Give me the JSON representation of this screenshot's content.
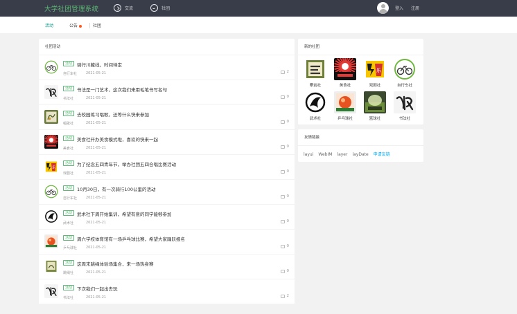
{
  "header": {
    "logo": "大学社团管理系统",
    "nav": [
      {
        "label": "交流",
        "icon": "compass-icon"
      },
      {
        "label": "社团",
        "icon": "smile-icon"
      }
    ],
    "login": "登入",
    "register": "注册"
  },
  "subnav": {
    "items": [
      {
        "label": "活动",
        "active": true
      },
      {
        "label": "公告",
        "has_dot": true
      },
      {
        "label": "社团"
      }
    ]
  },
  "feed": {
    "title": "社团活动",
    "tag_label": "活动",
    "items": [
      {
        "title": "骑行川藏线，时间待定",
        "club": "自行车社",
        "date": "2021-05-21",
        "comments": "2",
        "avatar": "bike-logo"
      },
      {
        "title": "书法是一门艺术，这次我们来用毛笔书写名句",
        "club": "书法社",
        "date": "2021-05-21",
        "comments": "0",
        "avatar": "calligraphy-logo"
      },
      {
        "title": "去校园练习唱歌，还等什么快来参加",
        "club": "唱歌社",
        "date": "2021-05-21",
        "comments": "0",
        "avatar": "singing-logo"
      },
      {
        "title": "美食社开办美食模式啦，喜欢的快来一起",
        "club": "美食社",
        "date": "2021-05-21",
        "comments": "0",
        "avatar": "food-logo"
      },
      {
        "title": "为了纪念五四青年节，举办社团五四合唱比赛活动",
        "club": "戏剧社",
        "date": "2021-05-21",
        "comments": "0",
        "avatar": "drama-logo"
      },
      {
        "title": "10月30日，有一次骑行100公里的活动",
        "club": "自行车社",
        "date": "2021-05-21",
        "comments": "0",
        "avatar": "bike-logo"
      },
      {
        "title": "武术社下周开始集训，希望有意的同学能够参加",
        "club": "武术社",
        "date": "2021-05-21",
        "comments": "0",
        "avatar": "martial-logo"
      },
      {
        "title": "周六学校体育馆有一场乒乓球比赛，希望大家踊跃报名",
        "club": "乒乓球社",
        "date": "2021-05-21",
        "comments": "0",
        "avatar": "pingpong-logo"
      },
      {
        "title": "这周末跳绳体验场集合，来一场热身赛",
        "club": "跳绳社",
        "date": "2021-05-21",
        "comments": "0",
        "avatar": "rope-logo"
      },
      {
        "title": "下次我们一起出去玩",
        "club": "书法社",
        "date": "2021-05-21",
        "comments": "2",
        "avatar": "calligraphy-logo"
      }
    ]
  },
  "new_clubs": {
    "title": "新的社团",
    "items": [
      {
        "name": "攀岩社",
        "logo": "climb-logo"
      },
      {
        "name": "美食社",
        "logo": "food-logo"
      },
      {
        "name": "戏剧社",
        "logo": "drama-logo"
      },
      {
        "name": "自行车社",
        "logo": "bike-logo"
      },
      {
        "name": "武术社",
        "logo": "martial-logo"
      },
      {
        "name": "乒乓球社",
        "logo": "pingpong-logo"
      },
      {
        "name": "篮球社",
        "logo": "basketball-logo"
      },
      {
        "name": "书法社",
        "logo": "calligraphy-logo"
      }
    ]
  },
  "links": {
    "title": "友情链接",
    "items": [
      "layui",
      "WebIM",
      "layer",
      "layDate",
      "申请友链"
    ]
  },
  "colors": {
    "header_bg": "#393d49",
    "logo_green": "#5FB878",
    "active_teal": "#009688",
    "dot_red": "#FF5722",
    "link_blue": "#01AAED"
  }
}
